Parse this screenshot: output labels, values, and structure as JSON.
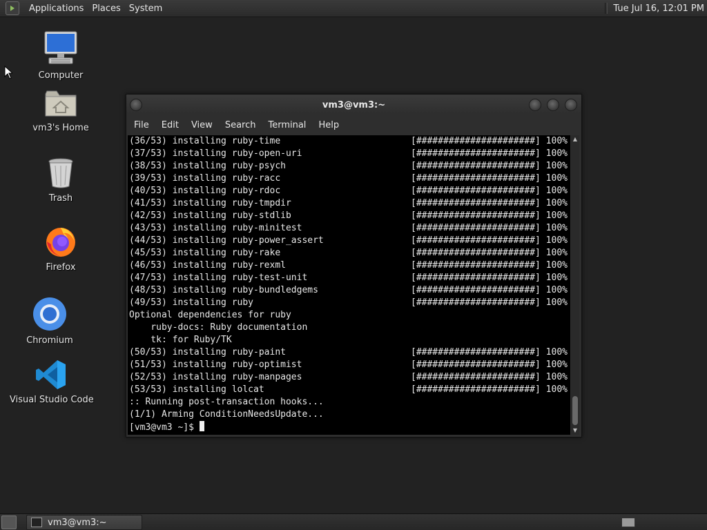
{
  "top_panel": {
    "menus": [
      "Applications",
      "Places",
      "System"
    ],
    "clock": "Tue Jul 16, 12:01 PM"
  },
  "desktop_icons": [
    {
      "label": "Computer",
      "icon": "computer-icon"
    },
    {
      "label": "vm3's Home",
      "icon": "home-folder-icon"
    },
    {
      "label": "Trash",
      "icon": "trash-icon"
    },
    {
      "label": "Firefox",
      "icon": "firefox-icon"
    },
    {
      "label": "Chromium",
      "icon": "chromium-icon"
    },
    {
      "label": "Visual Studio Code",
      "icon": "vscode-icon"
    }
  ],
  "window": {
    "title": "vm3@vm3:~",
    "menu": [
      "File",
      "Edit",
      "View",
      "Search",
      "Terminal",
      "Help"
    ]
  },
  "terminal": {
    "lines": [
      {
        "text": "(36/53) installing ruby-time",
        "progress": "[######################] 100%"
      },
      {
        "text": "(37/53) installing ruby-open-uri",
        "progress": "[######################] 100%"
      },
      {
        "text": "(38/53) installing ruby-psych",
        "progress": "[######################] 100%"
      },
      {
        "text": "(39/53) installing ruby-racc",
        "progress": "[######################] 100%"
      },
      {
        "text": "(40/53) installing ruby-rdoc",
        "progress": "[######################] 100%"
      },
      {
        "text": "(41/53) installing ruby-tmpdir",
        "progress": "[######################] 100%"
      },
      {
        "text": "(42/53) installing ruby-stdlib",
        "progress": "[######################] 100%"
      },
      {
        "text": "(43/53) installing ruby-minitest",
        "progress": "[######################] 100%"
      },
      {
        "text": "(44/53) installing ruby-power_assert",
        "progress": "[######################] 100%"
      },
      {
        "text": "(45/53) installing ruby-rake",
        "progress": "[######################] 100%"
      },
      {
        "text": "(46/53) installing ruby-rexml",
        "progress": "[######################] 100%"
      },
      {
        "text": "(47/53) installing ruby-test-unit",
        "progress": "[######################] 100%"
      },
      {
        "text": "(48/53) installing ruby-bundledgems",
        "progress": "[######################] 100%"
      },
      {
        "text": "(49/53) installing ruby",
        "progress": "[######################] 100%"
      },
      {
        "text": "Optional dependencies for ruby",
        "progress": ""
      },
      {
        "text": "    ruby-docs: Ruby documentation",
        "progress": ""
      },
      {
        "text": "    tk: for Ruby/TK",
        "progress": ""
      },
      {
        "text": "(50/53) installing ruby-paint",
        "progress": "[######################] 100%"
      },
      {
        "text": "(51/53) installing ruby-optimist",
        "progress": "[######################] 100%"
      },
      {
        "text": "(52/53) installing ruby-manpages",
        "progress": "[######################] 100%"
      },
      {
        "text": "(53/53) installing lolcat",
        "progress": "[######################] 100%"
      },
      {
        "text": ":: Running post-transaction hooks...",
        "progress": ""
      },
      {
        "text": "(1/1) Arming ConditionNeedsUpdate...",
        "progress": ""
      }
    ],
    "prompt": "[vm3@vm3 ~]$ "
  },
  "taskbar": {
    "task_label": "vm3@vm3:~"
  }
}
